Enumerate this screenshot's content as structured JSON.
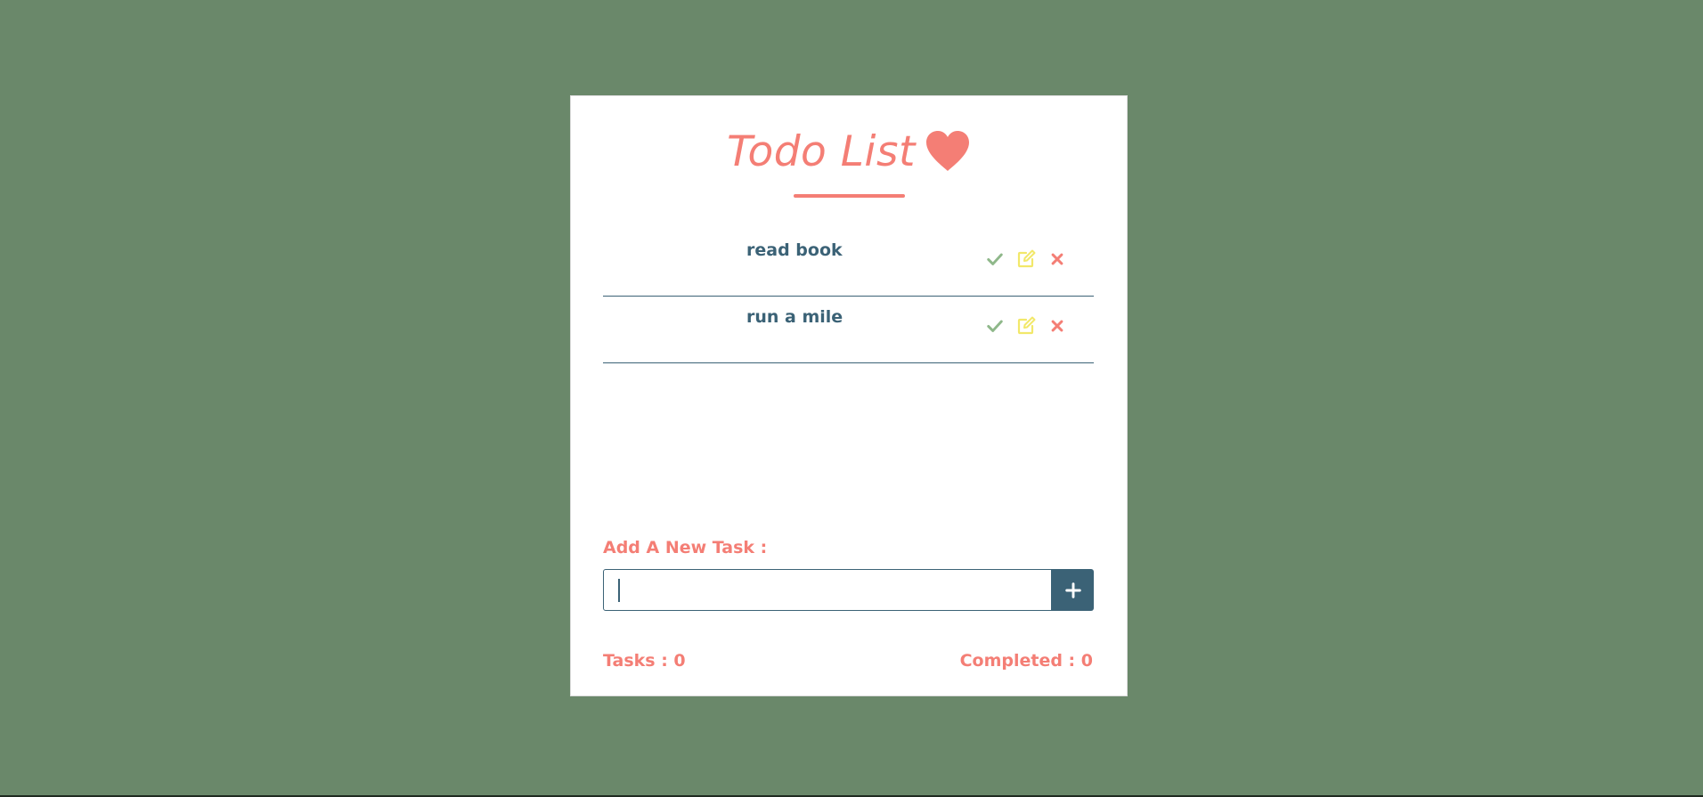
{
  "app": {
    "title": "Todo List",
    "title_icon": "heart-icon",
    "accent_color": "#f47e75",
    "primary_color": "#3b6276",
    "background_color": "#6a886a"
  },
  "tasks": [
    {
      "text": "read book"
    },
    {
      "text": "run a mile"
    }
  ],
  "actions": {
    "complete_icon": "check-icon",
    "edit_icon": "edit-icon",
    "delete_icon": "close-icon",
    "complete_color": "#8fb88a",
    "edit_color": "#f2e86a",
    "delete_color": "#f47e75"
  },
  "add_task": {
    "label": "Add A New Task :",
    "value": "",
    "button_icon": "plus-icon"
  },
  "footer": {
    "tasks_text": "Tasks : 0",
    "completed_text": "Completed : 0"
  }
}
